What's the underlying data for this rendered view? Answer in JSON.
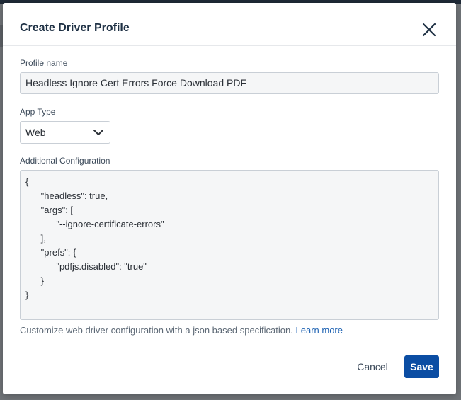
{
  "dialog": {
    "title": "Create Driver Profile"
  },
  "icons": {
    "close": "close-icon",
    "chevron": "chevron-down-icon"
  },
  "profile_name": {
    "label": "Profile name",
    "value": "Headless Ignore Cert Errors Force Download PDF"
  },
  "app_type": {
    "label": "App Type",
    "selected": "Web"
  },
  "additional_config": {
    "label": "Additional Configuration",
    "lines": [
      "{",
      "      \"headless\": true,",
      "      \"args\": [",
      "            \"--ignore-certificate-errors\"",
      "      ],",
      "      \"prefs\": {",
      "            \"pdfjs.disabled\": \"true\"",
      "      }",
      "}"
    ]
  },
  "help": {
    "text": "Customize web driver configuration with a json based specification.",
    "link": "Learn more"
  },
  "actions": {
    "cancel": "Cancel",
    "save": "Save"
  },
  "colors": {
    "primary": "#0b4da3",
    "link": "#1f63b3",
    "title": "#1e3044"
  }
}
